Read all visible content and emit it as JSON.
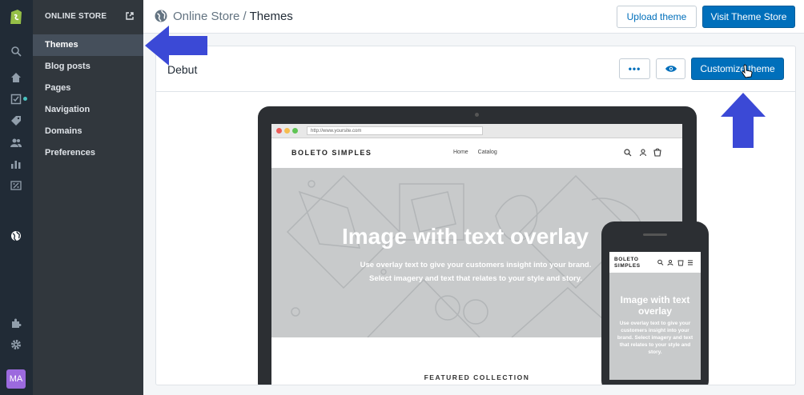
{
  "rail": {
    "avatar_initials": "MA",
    "icons": [
      "shopify-logo-icon",
      "search-icon",
      "home-icon",
      "orders-icon",
      "tag-icon",
      "customers-icon",
      "analytics-icon",
      "discounts-icon",
      "online-store-icon",
      "apps-icon",
      "settings-icon"
    ]
  },
  "subnav": {
    "heading": "ONLINE STORE",
    "items": [
      {
        "label": "Themes",
        "active": true
      },
      {
        "label": "Blog posts"
      },
      {
        "label": "Pages"
      },
      {
        "label": "Navigation"
      },
      {
        "label": "Domains"
      },
      {
        "label": "Preferences"
      }
    ]
  },
  "topbar": {
    "breadcrumb_parent": "Online Store",
    "breadcrumb_sep": " / ",
    "breadcrumb_current": "Themes",
    "upload_label": "Upload theme",
    "visit_label": "Visit Theme Store"
  },
  "theme_card": {
    "name": "Debut",
    "more_label": "•••",
    "customize_label": "Customize theme"
  },
  "preview": {
    "url": "http://www.yoursite.com",
    "brand": "BOLETO SIMPLES",
    "nav": [
      "Home",
      "Catalog"
    ],
    "hero_title": "Image with text overlay",
    "hero_sub_1": "Use overlay text to give your customers insight into your brand.",
    "hero_sub_2": "Select imagery and text that relates to your style and story.",
    "featured": "FEATURED COLLECTION",
    "mobile_brand_1": "BOLETO",
    "mobile_brand_2": "SIMPLES",
    "mobile_title": "Image with text overlay",
    "mobile_sub": "Use overlay text to give your customers insight into your brand. Select imagery and text that relates to your style and story."
  },
  "colors": {
    "primary": "#006fbb",
    "annotation_arrow": "#3b49d6"
  }
}
